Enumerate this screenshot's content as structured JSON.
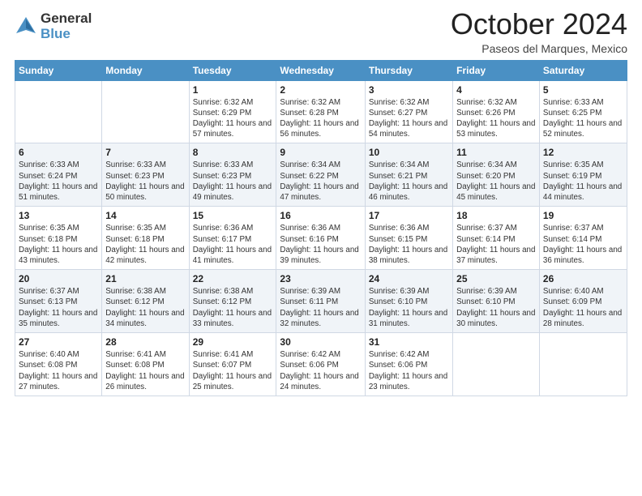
{
  "logo": {
    "general": "General",
    "blue": "Blue"
  },
  "title": "October 2024",
  "location": "Paseos del Marques, Mexico",
  "days_of_week": [
    "Sunday",
    "Monday",
    "Tuesday",
    "Wednesday",
    "Thursday",
    "Friday",
    "Saturday"
  ],
  "weeks": [
    [
      {
        "day": "",
        "info": ""
      },
      {
        "day": "",
        "info": ""
      },
      {
        "day": "1",
        "info": "Sunrise: 6:32 AM\nSunset: 6:29 PM\nDaylight: 11 hours and 57 minutes."
      },
      {
        "day": "2",
        "info": "Sunrise: 6:32 AM\nSunset: 6:28 PM\nDaylight: 11 hours and 56 minutes."
      },
      {
        "day": "3",
        "info": "Sunrise: 6:32 AM\nSunset: 6:27 PM\nDaylight: 11 hours and 54 minutes."
      },
      {
        "day": "4",
        "info": "Sunrise: 6:32 AM\nSunset: 6:26 PM\nDaylight: 11 hours and 53 minutes."
      },
      {
        "day": "5",
        "info": "Sunrise: 6:33 AM\nSunset: 6:25 PM\nDaylight: 11 hours and 52 minutes."
      }
    ],
    [
      {
        "day": "6",
        "info": "Sunrise: 6:33 AM\nSunset: 6:24 PM\nDaylight: 11 hours and 51 minutes."
      },
      {
        "day": "7",
        "info": "Sunrise: 6:33 AM\nSunset: 6:23 PM\nDaylight: 11 hours and 50 minutes."
      },
      {
        "day": "8",
        "info": "Sunrise: 6:33 AM\nSunset: 6:23 PM\nDaylight: 11 hours and 49 minutes."
      },
      {
        "day": "9",
        "info": "Sunrise: 6:34 AM\nSunset: 6:22 PM\nDaylight: 11 hours and 47 minutes."
      },
      {
        "day": "10",
        "info": "Sunrise: 6:34 AM\nSunset: 6:21 PM\nDaylight: 11 hours and 46 minutes."
      },
      {
        "day": "11",
        "info": "Sunrise: 6:34 AM\nSunset: 6:20 PM\nDaylight: 11 hours and 45 minutes."
      },
      {
        "day": "12",
        "info": "Sunrise: 6:35 AM\nSunset: 6:19 PM\nDaylight: 11 hours and 44 minutes."
      }
    ],
    [
      {
        "day": "13",
        "info": "Sunrise: 6:35 AM\nSunset: 6:18 PM\nDaylight: 11 hours and 43 minutes."
      },
      {
        "day": "14",
        "info": "Sunrise: 6:35 AM\nSunset: 6:18 PM\nDaylight: 11 hours and 42 minutes."
      },
      {
        "day": "15",
        "info": "Sunrise: 6:36 AM\nSunset: 6:17 PM\nDaylight: 11 hours and 41 minutes."
      },
      {
        "day": "16",
        "info": "Sunrise: 6:36 AM\nSunset: 6:16 PM\nDaylight: 11 hours and 39 minutes."
      },
      {
        "day": "17",
        "info": "Sunrise: 6:36 AM\nSunset: 6:15 PM\nDaylight: 11 hours and 38 minutes."
      },
      {
        "day": "18",
        "info": "Sunrise: 6:37 AM\nSunset: 6:14 PM\nDaylight: 11 hours and 37 minutes."
      },
      {
        "day": "19",
        "info": "Sunrise: 6:37 AM\nSunset: 6:14 PM\nDaylight: 11 hours and 36 minutes."
      }
    ],
    [
      {
        "day": "20",
        "info": "Sunrise: 6:37 AM\nSunset: 6:13 PM\nDaylight: 11 hours and 35 minutes."
      },
      {
        "day": "21",
        "info": "Sunrise: 6:38 AM\nSunset: 6:12 PM\nDaylight: 11 hours and 34 minutes."
      },
      {
        "day": "22",
        "info": "Sunrise: 6:38 AM\nSunset: 6:12 PM\nDaylight: 11 hours and 33 minutes."
      },
      {
        "day": "23",
        "info": "Sunrise: 6:39 AM\nSunset: 6:11 PM\nDaylight: 11 hours and 32 minutes."
      },
      {
        "day": "24",
        "info": "Sunrise: 6:39 AM\nSunset: 6:10 PM\nDaylight: 11 hours and 31 minutes."
      },
      {
        "day": "25",
        "info": "Sunrise: 6:39 AM\nSunset: 6:10 PM\nDaylight: 11 hours and 30 minutes."
      },
      {
        "day": "26",
        "info": "Sunrise: 6:40 AM\nSunset: 6:09 PM\nDaylight: 11 hours and 28 minutes."
      }
    ],
    [
      {
        "day": "27",
        "info": "Sunrise: 6:40 AM\nSunset: 6:08 PM\nDaylight: 11 hours and 27 minutes."
      },
      {
        "day": "28",
        "info": "Sunrise: 6:41 AM\nSunset: 6:08 PM\nDaylight: 11 hours and 26 minutes."
      },
      {
        "day": "29",
        "info": "Sunrise: 6:41 AM\nSunset: 6:07 PM\nDaylight: 11 hours and 25 minutes."
      },
      {
        "day": "30",
        "info": "Sunrise: 6:42 AM\nSunset: 6:06 PM\nDaylight: 11 hours and 24 minutes."
      },
      {
        "day": "31",
        "info": "Sunrise: 6:42 AM\nSunset: 6:06 PM\nDaylight: 11 hours and 23 minutes."
      },
      {
        "day": "",
        "info": ""
      },
      {
        "day": "",
        "info": ""
      }
    ]
  ]
}
